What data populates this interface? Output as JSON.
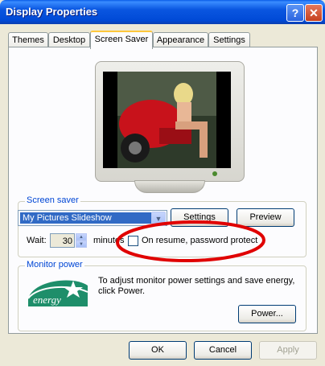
{
  "window": {
    "title": "Display Properties"
  },
  "titlebar": {
    "help_glyph": "?",
    "close_glyph": "✕"
  },
  "tabs": [
    {
      "label": "Themes",
      "active": false
    },
    {
      "label": "Desktop",
      "active": false
    },
    {
      "label": "Screen Saver",
      "active": true
    },
    {
      "label": "Appearance",
      "active": false
    },
    {
      "label": "Settings",
      "active": false
    }
  ],
  "screen_saver": {
    "group_label": "Screen saver",
    "selected": "My Pictures Slideshow",
    "settings_label": "Settings",
    "preview_label": "Preview",
    "wait_label": "Wait:",
    "wait_value": "30",
    "minutes_label": "minutes",
    "checkbox_label": "On resume, password protect",
    "checkbox_checked": false
  },
  "monitor_power": {
    "group_label": "Monitor power",
    "description": "To adjust monitor power settings and save energy, click Power.",
    "power_label": "Power...",
    "logo_text": "energy"
  },
  "dialog_buttons": {
    "ok": "OK",
    "cancel": "Cancel",
    "apply": "Apply"
  },
  "colors": {
    "title_bar": "#0A56E0",
    "accent_tab": "#FFC83C",
    "annotation": "#E00000",
    "selection": "#316AC5"
  }
}
